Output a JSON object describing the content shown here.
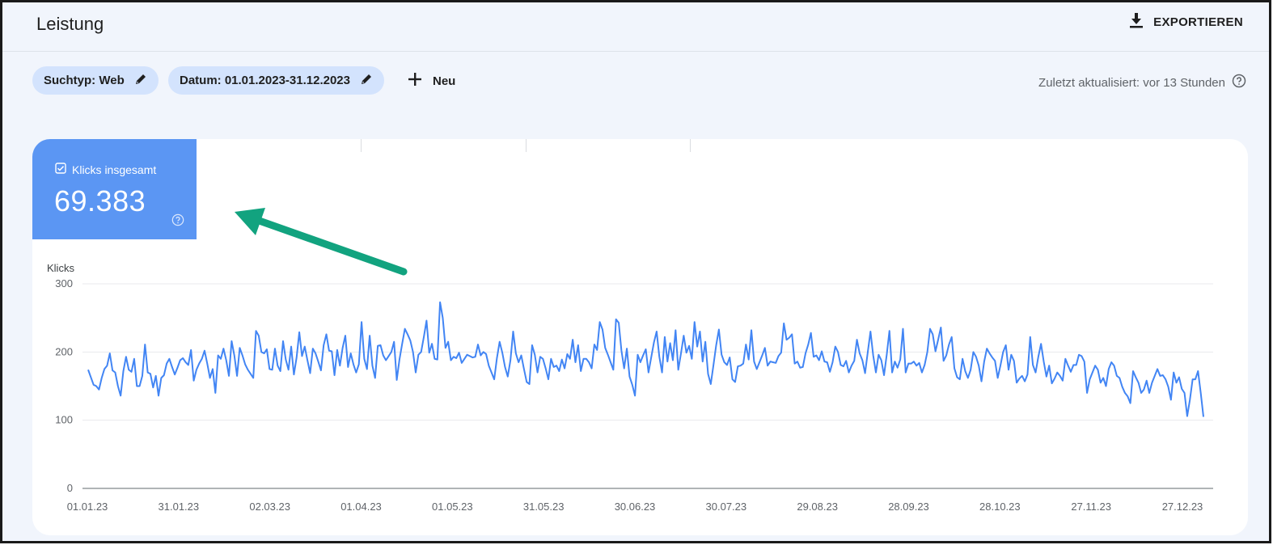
{
  "header": {
    "title": "Leistung",
    "export_label": "EXPORTIEREN",
    "export_icon": "download-icon"
  },
  "filters": {
    "chips": [
      {
        "label": "Suchtyp: Web",
        "icon": "pencil-icon"
      },
      {
        "label": "Datum: 01.01.2023-31.12.2023",
        "icon": "pencil-icon"
      }
    ],
    "new_label": "Neu",
    "new_icon": "plus-icon"
  },
  "status": {
    "updated": "Zuletzt aktualisiert: vor 13 Stunden",
    "help_icon": "help-icon"
  },
  "metric": {
    "label": "Klicks insgesamt",
    "value": "69.383",
    "checkbox_checked": true,
    "color": "#5b96f3"
  },
  "annotation": {
    "arrow_color": "#12a37f",
    "arrow_icon": "arrow-pointer"
  },
  "colors": {
    "background": "#f1f5fc",
    "chip": "#d3e3fd",
    "line": "#4285f4"
  },
  "chart_data": {
    "type": "line",
    "ylabel": "Klicks",
    "ylim": [
      0,
      300
    ],
    "yticks": [
      0,
      100,
      200,
      300
    ],
    "x_range": [
      "01.01.23",
      "31.12.23"
    ],
    "xticks": [
      "01.01.23",
      "31.01.23",
      "02.03.23",
      "01.04.23",
      "01.05.23",
      "31.05.23",
      "30.06.23",
      "30.07.23",
      "29.08.23",
      "28.09.23",
      "28.10.23",
      "27.11.23",
      "27.12.23"
    ],
    "grid": true,
    "series": [
      {
        "color": "#4285f4",
        "values": [
          174,
          163,
          152,
          150,
          145,
          162,
          175,
          180,
          198,
          173,
          170,
          150,
          136,
          172,
          193,
          174,
          171,
          190,
          150,
          150,
          165,
          211,
          170,
          168,
          148,
          165,
          136,
          162,
          166,
          183,
          190,
          178,
          167,
          177,
          188,
          191,
          185,
          181,
          203,
          158,
          174,
          183,
          190,
          202,
          183,
          162,
          175,
          140,
          195,
          190,
          205,
          188,
          165,
          216,
          195,
          165,
          206,
          195,
          182,
          174,
          168,
          162,
          231,
          224,
          200,
          198,
          204,
          175,
          174,
          205,
          180,
          172,
          216,
          189,
          174,
          208,
          167,
          192,
          229,
          194,
          208,
          188,
          169,
          205,
          198,
          186,
          173,
          210,
          226,
          202,
          201,
          166,
          203,
          180,
          206,
          224,
          178,
          198,
          182,
          170,
          182,
          244,
          190,
          175,
          224,
          180,
          162,
          209,
          210,
          195,
          188,
          194,
          200,
          215,
          159,
          189,
          212,
          234,
          226,
          217,
          200,
          170,
          196,
          200,
          222,
          246,
          199,
          212,
          190,
          189,
          273,
          250,
          206,
          215,
          188,
          193,
          191,
          199,
          184,
          190,
          196,
          194,
          192,
          193,
          211,
          195,
          200,
          197,
          180,
          170,
          160,
          191,
          215,
          199,
          178,
          164,
          188,
          230,
          198,
          185,
          195,
          175,
          156,
          153,
          210,
          196,
          170,
          193,
          190,
          176,
          160,
          190,
          178,
          180,
          172,
          189,
          176,
          197,
          190,
          218,
          185,
          210,
          172,
          190,
          190,
          185,
          176,
          211,
          203,
          244,
          233,
          206,
          196,
          185,
          174,
          248,
          243,
          202,
          176,
          205,
          164,
          152,
          136,
          196,
          185,
          195,
          204,
          170,
          192,
          214,
          230,
          193,
          170,
          222,
          186,
          213,
          188,
          232,
          174,
          198,
          224,
          199,
          209,
          190,
          244,
          208,
          230,
          186,
          215,
          168,
          153,
          181,
          210,
          233,
          196,
          185,
          181,
          192,
          160,
          156,
          179,
          180,
          183,
          211,
          189,
          232,
          186,
          175,
          185,
          195,
          206,
          180,
          186,
          185,
          184,
          194,
          199,
          242,
          218,
          221,
          226,
          183,
          186,
          177,
          178,
          198,
          211,
          228,
          193,
          195,
          188,
          201,
          186,
          185,
          171,
          185,
          208,
          200,
          181,
          179,
          187,
          170,
          180,
          187,
          218,
          198,
          188,
          169,
          200,
          230,
          195,
          170,
          196,
          188,
          166,
          196,
          231,
          170,
          186,
          177,
          189,
          234,
          170,
          183,
          183,
          186,
          180,
          184,
          170,
          181,
          200,
          234,
          226,
          201,
          218,
          236,
          187,
          195,
          211,
          222,
          176,
          163,
          160,
          190,
          172,
          162,
          174,
          200,
          193,
          180,
          157,
          186,
          205,
          198,
          192,
          187,
          162,
          180,
          200,
          210,
          174,
          196,
          187,
          155,
          161,
          165,
          157,
          167,
          222,
          181,
          170,
          193,
          212,
          186,
          164,
          180,
          154,
          161,
          170,
          165,
          158,
          190,
          180,
          171,
          181,
          181,
          196,
          194,
          186,
          140,
          160,
          170,
          180,
          174,
          155,
          162,
          150,
          175,
          185,
          180,
          165,
          162,
          149,
          140,
          135,
          125,
          172,
          163,
          155,
          140,
          145,
          158,
          140,
          155,
          165,
          175,
          165,
          166,
          160,
          149,
          130,
          170,
          155,
          163,
          146,
          140,
          106,
          130,
          160,
          160,
          172,
          140,
          105
        ]
      }
    ]
  }
}
